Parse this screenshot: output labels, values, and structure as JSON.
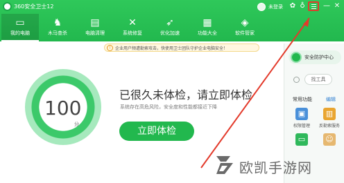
{
  "window": {
    "title": "360安全卫士12",
    "login_text": "未登录",
    "controls": [
      "skin-icon",
      "menu-icon",
      "minimize-icon",
      "close-icon"
    ]
  },
  "nav": {
    "items": [
      {
        "label": "我的电脑",
        "icon": "monitor-icon",
        "active": true
      },
      {
        "label": "木马查杀",
        "icon": "horse-icon",
        "active": false
      },
      {
        "label": "电脑清理",
        "icon": "broom-icon",
        "active": false
      },
      {
        "label": "系统修复",
        "icon": "wrench-icon",
        "active": false
      },
      {
        "label": "优化加速",
        "icon": "rocket-icon",
        "active": false
      },
      {
        "label": "功能大全",
        "icon": "grid-icon",
        "active": false
      },
      {
        "label": "软件管家",
        "icon": "package-icon",
        "active": false
      }
    ]
  },
  "notice": {
    "text": "企业用户频遭勒索攻击，快使用卫士团队守护企业电脑安全！"
  },
  "scan": {
    "score": "100",
    "score_unit": "分",
    "headline": "已很久未体检，请立即体检",
    "subline": "系统存在高危风险，安全度和性能都接近下降",
    "button": "立即体检"
  },
  "sidebar": {
    "protection_label": "安全防护中心",
    "find_tool": "找工具",
    "common_label": "常用功能",
    "edit_label": "编辑",
    "tools": [
      {
        "label": "权限管理",
        "icon": "permission-icon",
        "color": "#4a90d9"
      },
      {
        "label": "反勒索服务",
        "icon": "shield-icon",
        "color": "#e9a530"
      }
    ]
  },
  "watermark": {
    "text": "欧凯手游网"
  },
  "colors": {
    "brand_green": "#22b84e",
    "annotation_red": "#e33a2b",
    "link_blue": "#2f7fd1"
  }
}
